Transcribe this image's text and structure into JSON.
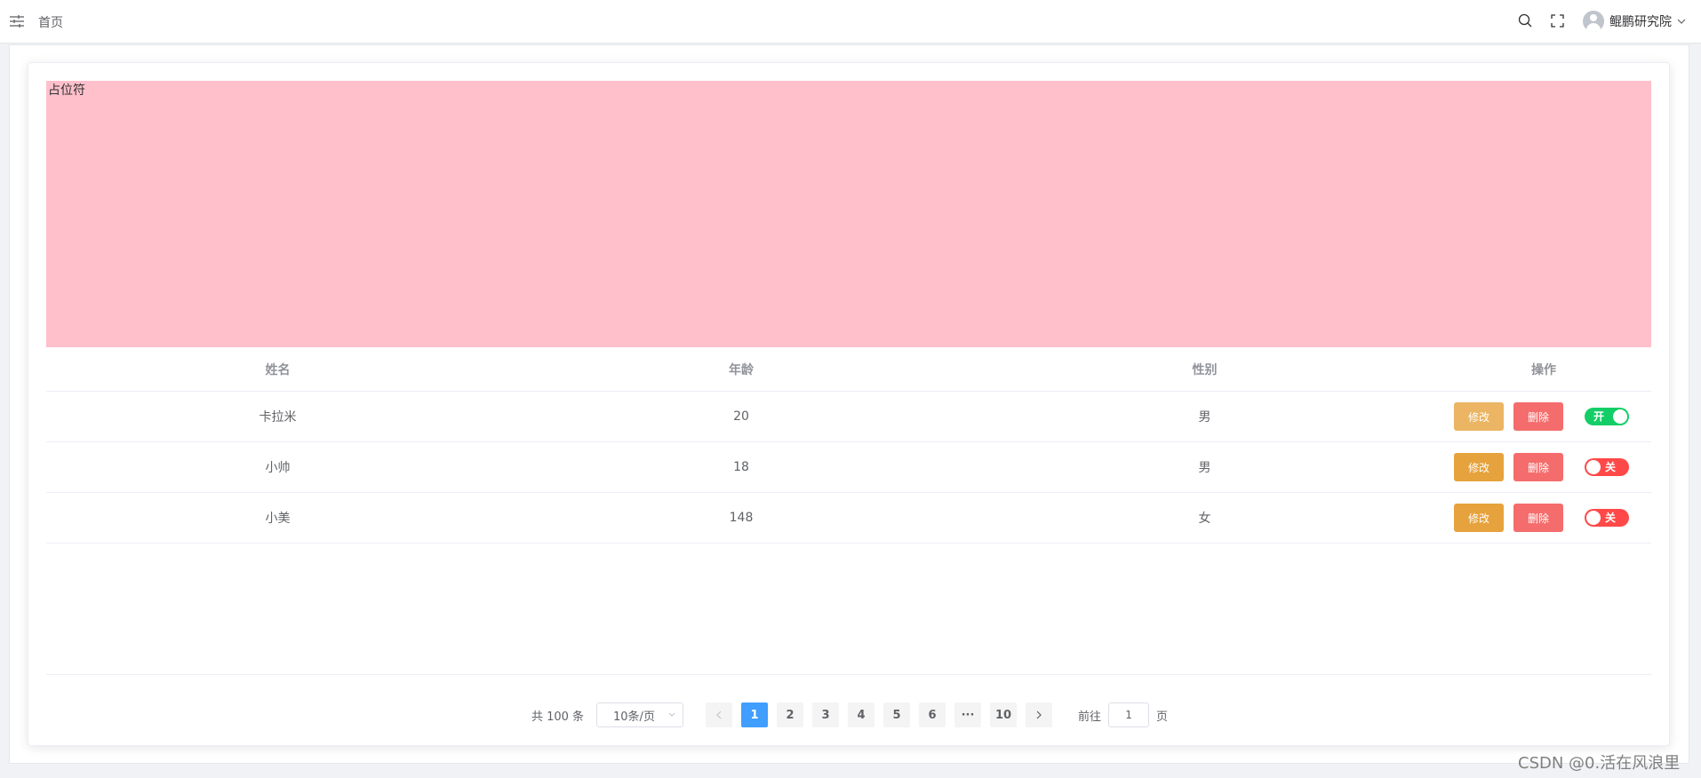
{
  "header": {
    "breadcrumb": "首页",
    "user_name": "鲲鹏研究院"
  },
  "placeholder_text": "占位符",
  "table": {
    "columns": [
      "姓名",
      "年龄",
      "性别",
      "操作"
    ],
    "rows": [
      {
        "name": "卡拉米",
        "age": "20",
        "gender": "男",
        "edit": "修改",
        "delete": "删除",
        "switch_label": "开",
        "switch_on": true
      },
      {
        "name": "小帅",
        "age": "18",
        "gender": "男",
        "edit": "修改",
        "delete": "删除",
        "switch_label": "关",
        "switch_on": false
      },
      {
        "name": "小美",
        "age": "148",
        "gender": "女",
        "edit": "修改",
        "delete": "删除",
        "switch_label": "关",
        "switch_on": false
      }
    ]
  },
  "pagination": {
    "total_text": "共 100 条",
    "page_size": "10条/页",
    "pages": [
      "1",
      "2",
      "3",
      "4",
      "5",
      "6",
      "···",
      "10"
    ],
    "current_page": "1",
    "goto_prefix": "前往",
    "goto_value": "1",
    "goto_suffix": "页"
  },
  "watermark": "CSDN @0.活在风浪里",
  "colors": {
    "placeholder_bg": "#ffc0cb",
    "edit": "#e6a23c",
    "delete": "#f56c6c",
    "switch_on": "#13ce66",
    "switch_off": "#ff4949",
    "pager_active": "#409eff"
  }
}
